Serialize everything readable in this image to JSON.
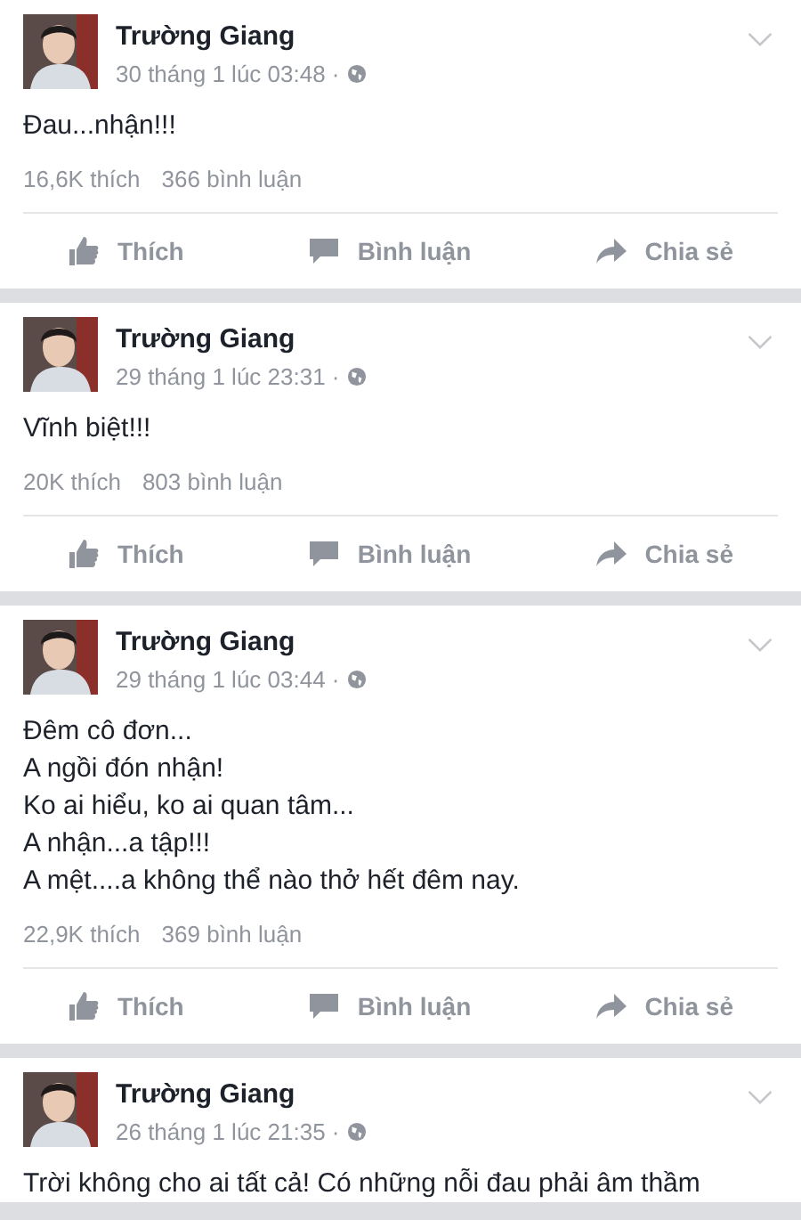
{
  "posts": [
    {
      "author": "Trường Giang",
      "time": "30 tháng 1 lúc 03:48 ·",
      "lines": [
        "Đau...nhận!!!"
      ],
      "likes": "16,6K thích",
      "comments": "366 bình luận",
      "actions": [
        "Thích",
        "Bình luận",
        "Chia sẻ"
      ]
    },
    {
      "author": "Trường Giang",
      "time": "29 tháng 1 lúc 23:31 ·",
      "lines": [
        "Vĩnh biệt!!!"
      ],
      "likes": "20K thích",
      "comments": "803 bình luận",
      "actions": [
        "Thích",
        "Bình luận",
        "Chia sẻ"
      ]
    },
    {
      "author": "Trường Giang",
      "time": "29 tháng 1 lúc 03:44 ·",
      "lines": [
        "Đêm cô đơn...",
        "A ngồi đón nhận!",
        "Ko ai hiểu, ko ai quan tâm...",
        "A nhận...a tập!!!",
        "A mệt....a không thể nào thở hết đêm nay."
      ],
      "likes": "22,9K thích",
      "comments": "369 bình luận",
      "actions": [
        "Thích",
        "Bình luận",
        "Chia sẻ"
      ]
    },
    {
      "author": "Trường Giang",
      "time": "26 tháng 1 lúc 21:35 ·",
      "lines": [
        "Trời không cho ai tất cả! Có những nỗi đau phải âm thầm"
      ]
    }
  ]
}
